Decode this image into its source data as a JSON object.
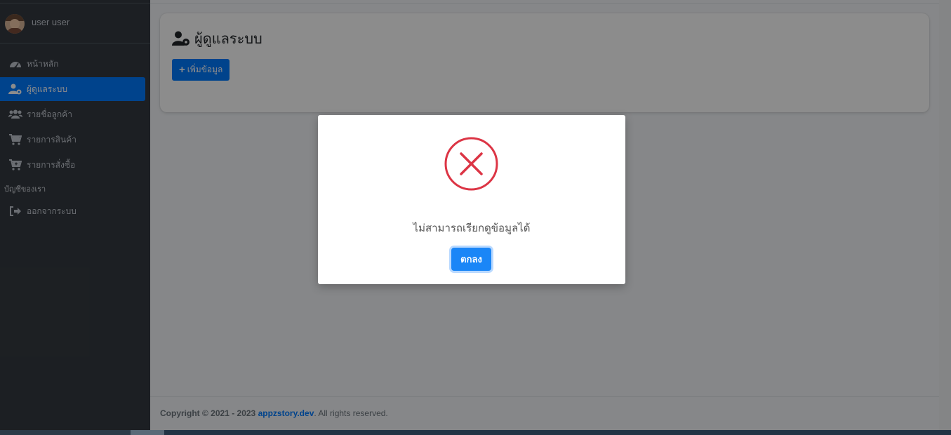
{
  "user": {
    "name": "user user"
  },
  "sidebar": {
    "items": [
      {
        "label": "หน้าหลัก",
        "icon": "dashboard-icon"
      },
      {
        "label": "ผู้ดูแลระบบ",
        "icon": "user-cog-icon",
        "active": true
      },
      {
        "label": "รายชื่อลูกค้า",
        "icon": "users-icon"
      },
      {
        "label": "รายการสินค้า",
        "icon": "cart-icon"
      },
      {
        "label": "รายการสั่งซื้อ",
        "icon": "cart-plus-icon"
      }
    ],
    "section_header": "บัญชีของเรา",
    "logout": {
      "label": "ออกจากระบบ",
      "icon": "sign-out-icon"
    }
  },
  "page": {
    "title": "ผู้ดูแลระบบ",
    "add_button": "เพิ่มข้อมูล"
  },
  "footer": {
    "prefix": "Copyright © 2021 - 2023 ",
    "link": "appzstory.dev",
    "suffix": ". All rights reserved."
  },
  "modal": {
    "icon": "error-x-icon",
    "message": "ไม่สามารถเรียกดูข้อมูลได้",
    "ok_button": "ตกลง"
  },
  "colors": {
    "sidebar_bg": "#343a40",
    "primary": "#007bff",
    "error": "#dc3545"
  }
}
